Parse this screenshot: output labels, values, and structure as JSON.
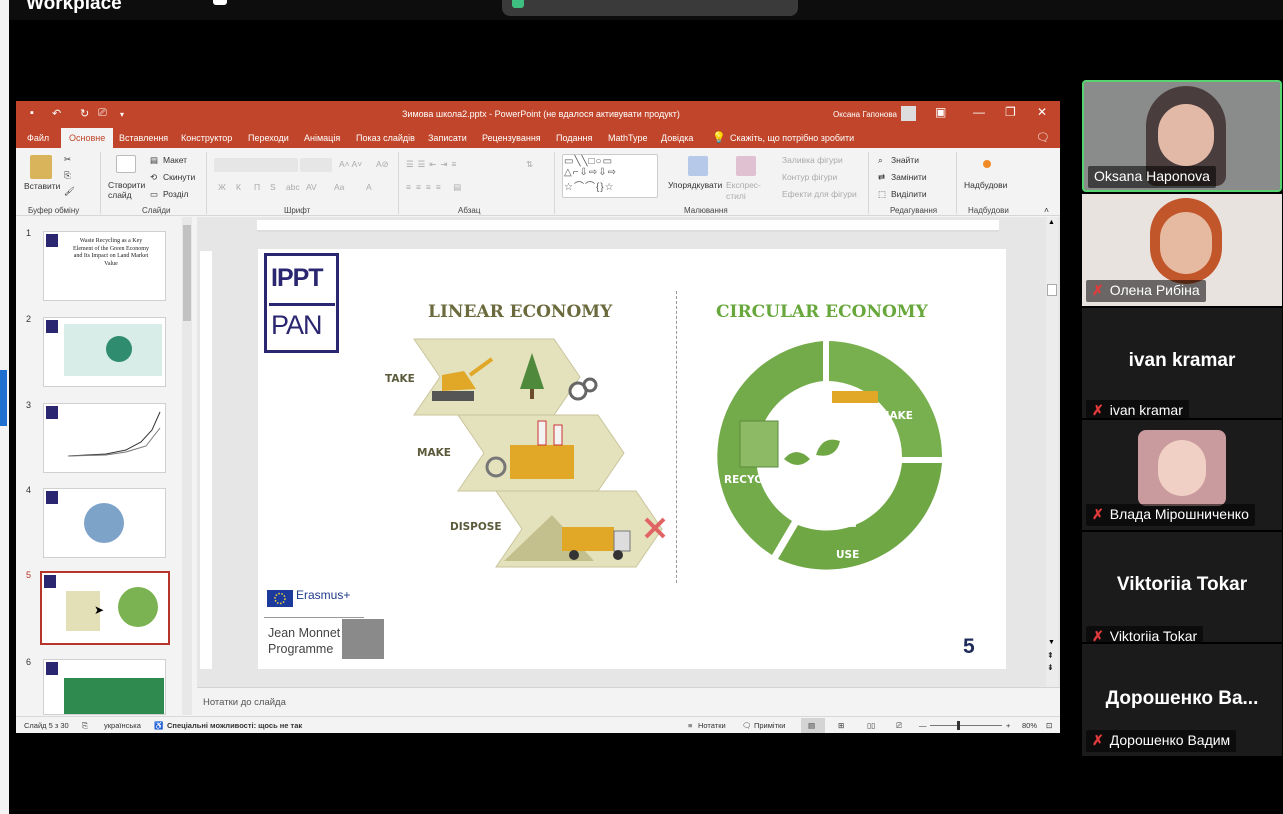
{
  "meeting": {
    "app_name": "Workplace",
    "participants": [
      {
        "name": "Oksana Haponova",
        "muted": false,
        "active": true
      },
      {
        "name": "Олена Рибіна",
        "muted": true
      },
      {
        "name": "ivan kramar",
        "muted": true,
        "display_name": "ivan kramar"
      },
      {
        "name": "Влада Мірошниченко",
        "muted": true
      },
      {
        "name": "Viktoriia Tokar",
        "muted": true,
        "display_name": "Viktoriia Tokar"
      },
      {
        "name": "Дорошенко Вадим",
        "muted": true,
        "display_name": "Дорошенко Ва..."
      }
    ]
  },
  "ppt": {
    "doc_title": "Зимова школа2.pptx  -  PowerPoint (не вдалося активувати продукт)",
    "user_name": "Оксана Гапонова",
    "menu": [
      "Файл",
      "Основне",
      "Вставлення",
      "Конструктор",
      "Переходи",
      "Анімація",
      "Показ слайдів",
      "Записати",
      "Рецензування",
      "Подання",
      "MathType",
      "Довідка"
    ],
    "tell_me": "Скажіть, що потрібно зробити",
    "ribbon": {
      "paste": "Вставити",
      "new_slide": "Створити слайд",
      "layout": "Макет",
      "reset": "Скинути",
      "section": "Розділ",
      "arrange": "Упорядкувати",
      "quick_styles": "Експрес-стилі",
      "shape_fill": "Заливка фігури",
      "shape_outline": "Контур фігури",
      "shape_effects": "Ефекти для фігури",
      "find": "Знайти",
      "replace": "Замінити",
      "select": "Виділити",
      "designer": "Надбудови",
      "groups": [
        "Буфер обміну",
        "Слайди",
        "Шрифт",
        "Абзац",
        "Малювання",
        "Редагування",
        "Надбудови"
      ],
      "font_buttons": [
        "Ж",
        "К",
        "П",
        "S",
        "abc",
        "AV",
        "Aa",
        "A"
      ]
    },
    "thumbnails": [
      {
        "num": "1",
        "title": "Waste Recycling as a Key Element of the Green Economy and Its Impact on Land Market Value"
      },
      {
        "num": "2"
      },
      {
        "num": "3"
      },
      {
        "num": "4"
      },
      {
        "num": "5",
        "selected": true
      },
      {
        "num": "6"
      }
    ],
    "slide": {
      "logo_top": "IPPT",
      "logo_bottom": "PAN",
      "linear_title": "LINEAR ECONOMY",
      "circular_title": "CIRCULAR ECONOMY",
      "linear_steps": [
        "TAKE",
        "MAKE",
        "DISPOSE"
      ],
      "circular_steps": [
        "MAKE",
        "RECYCLE",
        "USE"
      ],
      "erasmus": "Erasmus+",
      "jean_monnet": "Jean Monnet",
      "programme": "Programme",
      "number": "5"
    },
    "notes_placeholder": "Нотатки до слайда",
    "status": {
      "slide_of": "Слайд 5 з 30",
      "language": "українська",
      "accessibility": "Спеціальні можливості: щось не так",
      "notes": "Нотатки",
      "comments": "Примітки",
      "zoom": "80%"
    },
    "colors": {
      "accent": "#c0452a",
      "linear": "#6b6a3c",
      "circular": "#67a73c",
      "logo": "#2a2670"
    }
  }
}
